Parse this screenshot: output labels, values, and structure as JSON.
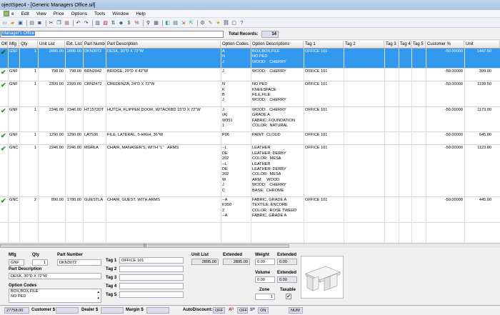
{
  "window": {
    "title": "ojectSpec4 - [Generic Managers Office.sif]"
  },
  "menu": [
    {
      "label": "e",
      "id": "file"
    },
    {
      "label": "Edit",
      "id": "edit"
    },
    {
      "label": "View",
      "id": "view"
    },
    {
      "label": "Price",
      "id": "price"
    },
    {
      "label": "Options",
      "id": "options"
    },
    {
      "label": "Tools",
      "id": "tools"
    },
    {
      "label": "Window",
      "id": "window"
    },
    {
      "label": "Help",
      "id": "help"
    }
  ],
  "toolbar_icons": [
    {
      "name": "new-icon",
      "glyph": "▭",
      "color": "#666"
    },
    {
      "name": "open-icon",
      "glyph": "▰",
      "color": "#d8a020"
    },
    {
      "name": "save-icon",
      "glyph": "▣",
      "color": "#335599"
    },
    {
      "name": "sep"
    },
    {
      "name": "print-icon",
      "glyph": "▤",
      "color": "#555"
    },
    {
      "name": "preview-icon",
      "glyph": "◙",
      "color": "#447"
    },
    {
      "name": "sep"
    },
    {
      "name": "cut-icon",
      "glyph": "✂",
      "color": "#333"
    },
    {
      "name": "copy-icon",
      "glyph": "❐",
      "color": "#335"
    },
    {
      "name": "paste-icon",
      "glyph": "▦",
      "color": "#a76"
    },
    {
      "name": "sep"
    },
    {
      "name": "undo-icon",
      "glyph": "↶",
      "color": "#335"
    },
    {
      "name": "redo-icon",
      "glyph": "↷",
      "color": "#335"
    },
    {
      "name": "sep"
    },
    {
      "name": "insert-row-icon",
      "glyph": "▥",
      "color": "#357"
    },
    {
      "name": "delete-row-icon",
      "glyph": "▧",
      "color": "#a33"
    },
    {
      "name": "sort-icon",
      "glyph": "⇅",
      "color": "#335"
    },
    {
      "name": "catalog-icon",
      "glyph": "◆",
      "color": "#2a6ab0"
    },
    {
      "name": "dollar-icon",
      "glyph": "$",
      "color": "#1a7a1a"
    },
    {
      "name": "percent-icon",
      "glyph": "%",
      "color": "#a33"
    },
    {
      "name": "sep"
    },
    {
      "name": "binoculars-icon",
      "glyph": "⚲",
      "color": "#224"
    },
    {
      "name": "calculator-icon",
      "glyph": "▦",
      "color": "#556"
    },
    {
      "name": "sep"
    },
    {
      "name": "graph-icon",
      "glyph": "◧",
      "color": "#3a8"
    },
    {
      "name": "report-icon",
      "glyph": "▤",
      "color": "#268"
    },
    {
      "name": "export-icon",
      "glyph": "⇲",
      "color": "#a60"
    },
    {
      "name": "import-icon",
      "glyph": "⇱",
      "color": "#2a6"
    },
    {
      "name": "sep"
    },
    {
      "name": "settings-icon",
      "glyph": "⚙",
      "color": "#555"
    },
    {
      "name": "notes-icon",
      "glyph": "✎",
      "color": "#a70"
    },
    {
      "name": "star-icon",
      "glyph": "★",
      "color": "#d9a400"
    },
    {
      "name": "link-icon",
      "glyph": "⛓",
      "color": "#335"
    },
    {
      "name": "window-icon",
      "glyph": "▢",
      "color": "#446"
    },
    {
      "name": "help-icon",
      "glyph": "?",
      "color": "#1a4aa0"
    }
  ],
  "search": {
    "value": "Manager's Office"
  },
  "records": {
    "label": "Total Records:",
    "value": "14"
  },
  "columns": [
    {
      "key": "ok",
      "label": "OK"
    },
    {
      "key": "mfg",
      "label": "Mfg"
    },
    {
      "key": "qty",
      "label": "Qty"
    },
    {
      "key": "unit_list",
      "label": "Unit List"
    },
    {
      "key": "ext_list",
      "label": "Ext. List"
    },
    {
      "key": "part",
      "label": "Part Number"
    },
    {
      "key": "desc",
      "label": "Part Description"
    },
    {
      "key": "codes",
      "label": "Option Codes"
    },
    {
      "key": "odesc",
      "label": "Option Descriptions"
    },
    {
      "key": "tag1",
      "label": "Tag 1"
    },
    {
      "key": "tag2",
      "label": "Tag 2"
    },
    {
      "key": "tag3",
      "label": "Tag 3"
    },
    {
      "key": "tag4",
      "label": "Tag 4"
    },
    {
      "key": "tag5",
      "label": "Tag 5"
    },
    {
      "key": "cust",
      "label": "Customer %"
    },
    {
      "key": "unit",
      "label": "Unit"
    }
  ],
  "rows": [
    {
      "ok": "✔",
      "mfg": "GNF",
      "qty": "1",
      "unit_list": "2895.00",
      "ext_list": "2895.00",
      "part": "DKN3072",
      "desc": "DESK, 30\"D X 72\"W",
      "codes": [
        "A",
        "N",
        "J"
      ],
      "odesc": [
        "BOX,BOX,FILE",
        "NO PED",
        "WOOD:   CHERRY"
      ],
      "tag1": "OFFICE 101",
      "cust": "-50.00000",
      "unit": "1447.50"
    },
    {
      "ok": "✔",
      "mfg": "GNF",
      "qty": "1",
      "unit_list": "798.00",
      "ext_list": "798.00",
      "part": "BRN2042",
      "desc": "BRIDGE, 20\"D X 42\"W",
      "codes": [
        "J"
      ],
      "odesc": [
        "WOOD:   CHERRY"
      ],
      "tag1": "OFFICE 101",
      "cust": "-50.00000",
      "unit": "399.00"
    },
    {
      "ok": "✔",
      "mfg": "GNF",
      "qty": "1",
      "unit_list": "2399.00",
      "ext_list": "2399.00",
      "part": "CRN2472",
      "desc": "CREDENZA, 24\"D X 72\"W",
      "codes": [
        "N",
        "K",
        "B",
        "J"
      ],
      "odesc": [
        "NO PED",
        "KNEESPACE",
        "FILE,FILE",
        "WOOD:   CHERRY"
      ],
      "tag1": "OFFICE 101",
      "cust": "-50.00000",
      "unit": "1199.50"
    },
    {
      "ok": "✔",
      "mfg": "GNF",
      "qty": "1",
      "unit_list": "2346.00",
      "ext_list": "2346.00",
      "part": "HT1572DT",
      "desc": "HUTCH, FLIPPER DOOR, W/TACKBD 15\"D X 72\"W",
      "codes": [
        "J",
        "(A)",
        "W351",
        "1"
      ],
      "odesc": [
        "WOOD:   CHERRY",
        "GRADE A",
        "FABRIC: FOUNDATION",
        "COLOR:  NATURAL"
      ],
      "tag1": "OFFICE 101",
      "cust": "-50.00000",
      "unit": "1173.00"
    },
    {
      "ok": "✔",
      "mfg": "GNF",
      "qty": "1",
      "unit_list": "1290.00",
      "ext_list": "1290.00",
      "part": "LAT536",
      "desc": "FILE, LATERAL, 5-HIGH, 36\"W",
      "codes": [
        "P06"
      ],
      "odesc": [
        "PAINT:  CLOUD"
      ],
      "tag1": "OFFICE 101",
      "cust": "-50.00000",
      "unit": "645.00"
    },
    {
      "ok": "✔",
      "mfg": "GNC",
      "qty": "1",
      "unit_list": "2246.00",
      "ext_list": "2246.00",
      "part": "MGRLA",
      "desc": "CHAIR, MANAGER'S, WITH \"L\"   ARMS",
      "codes": [
        "--L",
        "DE",
        "202",
        "--L",
        "DE",
        "202",
        "W",
        "J",
        "C"
      ],
      "odesc": [
        "LEATHER",
        "LEATHER: DERBY",
        "COLOR:  MESA",
        "LEATHER",
        "LEATHER: DERBY",
        "COLOR:  MESA",
        "ARM:    WOOD",
        "WOOD:   CHERRY",
        "BASE:  CHROME"
      ],
      "tag1": "OFFICE 101",
      "cust": "-50.00000",
      "unit": "1123.00"
    },
    {
      "ok": "✔",
      "mfg": "GNC",
      "qty": "2",
      "unit_list": "890.00",
      "ext_list": "1780.00",
      "part": "GUESTLA",
      "desc": "CHAIR, GUEST, WITH ARMS",
      "codes": [
        "--A",
        "K350",
        "2",
        "--A"
      ],
      "odesc": [
        "FABRIC, GRADE A",
        "TEXTILE: ENCORE",
        "COLOR:  ROSE TWEED",
        "FABRIC, GRADE A"
      ],
      "tag1": "OFFICE 101",
      "cust": "-50.00000",
      "unit": "445.00"
    }
  ],
  "details": {
    "mfg_label": "Mfg",
    "mfg": "GNF",
    "qty_label": "Qty",
    "qty": "1",
    "part_label": "Part Number",
    "part": "DKN3072",
    "pdesc_label": "Part Description",
    "pdesc": "DESK, 30\"D X 72\"W",
    "ocodes_label": "Option Codes",
    "ocodes": [
      "BOX,BOX,FILE",
      "NO PED"
    ],
    "tags": [
      {
        "label": "Tag 1",
        "value": "OFFICE 101"
      },
      {
        "label": "Tag 2",
        "value": ""
      },
      {
        "label": "Tag 3",
        "value": ""
      },
      {
        "label": "Tag 4",
        "value": ""
      },
      {
        "label": "Tag 5",
        "value": ""
      }
    ],
    "unit_list_label": "Unit List",
    "unit_list": "2895.00",
    "extended_label": "Extended",
    "extended": "2895.00",
    "weight_label": "Weight",
    "weight": "0.00",
    "weight_ext_label": "Extended",
    "weight_ext": "0.00",
    "volume_label": "Volume",
    "volume": "0.00",
    "volume_ext_label": "Extended",
    "volume_ext": "0.00",
    "zone_label": "Zone",
    "zone": "1",
    "taxable_label": "Taxable",
    "taxable": "✔"
  },
  "status": {
    "total": "27758.00",
    "customer_label": "Customer $",
    "dealer_label": "Dealer $",
    "margin_label": "Margin $",
    "autodiscount_label": "AutoDiscount:",
    "autodiscount": "OFF",
    "ad_label": "Aᴰ",
    "ad_value": "OFF",
    "sn_label": "Sᴺ",
    "sn_value": "ON",
    "num": "NUM"
  }
}
